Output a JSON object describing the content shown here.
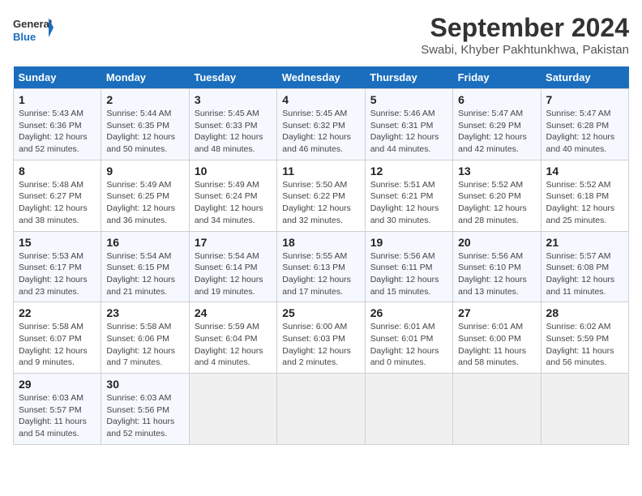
{
  "logo": {
    "text_general": "General",
    "text_blue": "Blue"
  },
  "title": "September 2024",
  "subtitle": "Swabi, Khyber Pakhtunkhwa, Pakistan",
  "days_of_week": [
    "Sunday",
    "Monday",
    "Tuesday",
    "Wednesday",
    "Thursday",
    "Friday",
    "Saturday"
  ],
  "weeks": [
    [
      {
        "day": "1",
        "info": "Sunrise: 5:43 AM\nSunset: 6:36 PM\nDaylight: 12 hours\nand 52 minutes."
      },
      {
        "day": "2",
        "info": "Sunrise: 5:44 AM\nSunset: 6:35 PM\nDaylight: 12 hours\nand 50 minutes."
      },
      {
        "day": "3",
        "info": "Sunrise: 5:45 AM\nSunset: 6:33 PM\nDaylight: 12 hours\nand 48 minutes."
      },
      {
        "day": "4",
        "info": "Sunrise: 5:45 AM\nSunset: 6:32 PM\nDaylight: 12 hours\nand 46 minutes."
      },
      {
        "day": "5",
        "info": "Sunrise: 5:46 AM\nSunset: 6:31 PM\nDaylight: 12 hours\nand 44 minutes."
      },
      {
        "day": "6",
        "info": "Sunrise: 5:47 AM\nSunset: 6:29 PM\nDaylight: 12 hours\nand 42 minutes."
      },
      {
        "day": "7",
        "info": "Sunrise: 5:47 AM\nSunset: 6:28 PM\nDaylight: 12 hours\nand 40 minutes."
      }
    ],
    [
      {
        "day": "8",
        "info": "Sunrise: 5:48 AM\nSunset: 6:27 PM\nDaylight: 12 hours\nand 38 minutes."
      },
      {
        "day": "9",
        "info": "Sunrise: 5:49 AM\nSunset: 6:25 PM\nDaylight: 12 hours\nand 36 minutes."
      },
      {
        "day": "10",
        "info": "Sunrise: 5:49 AM\nSunset: 6:24 PM\nDaylight: 12 hours\nand 34 minutes."
      },
      {
        "day": "11",
        "info": "Sunrise: 5:50 AM\nSunset: 6:22 PM\nDaylight: 12 hours\nand 32 minutes."
      },
      {
        "day": "12",
        "info": "Sunrise: 5:51 AM\nSunset: 6:21 PM\nDaylight: 12 hours\nand 30 minutes."
      },
      {
        "day": "13",
        "info": "Sunrise: 5:52 AM\nSunset: 6:20 PM\nDaylight: 12 hours\nand 28 minutes."
      },
      {
        "day": "14",
        "info": "Sunrise: 5:52 AM\nSunset: 6:18 PM\nDaylight: 12 hours\nand 25 minutes."
      }
    ],
    [
      {
        "day": "15",
        "info": "Sunrise: 5:53 AM\nSunset: 6:17 PM\nDaylight: 12 hours\nand 23 minutes."
      },
      {
        "day": "16",
        "info": "Sunrise: 5:54 AM\nSunset: 6:15 PM\nDaylight: 12 hours\nand 21 minutes."
      },
      {
        "day": "17",
        "info": "Sunrise: 5:54 AM\nSunset: 6:14 PM\nDaylight: 12 hours\nand 19 minutes."
      },
      {
        "day": "18",
        "info": "Sunrise: 5:55 AM\nSunset: 6:13 PM\nDaylight: 12 hours\nand 17 minutes."
      },
      {
        "day": "19",
        "info": "Sunrise: 5:56 AM\nSunset: 6:11 PM\nDaylight: 12 hours\nand 15 minutes."
      },
      {
        "day": "20",
        "info": "Sunrise: 5:56 AM\nSunset: 6:10 PM\nDaylight: 12 hours\nand 13 minutes."
      },
      {
        "day": "21",
        "info": "Sunrise: 5:57 AM\nSunset: 6:08 PM\nDaylight: 12 hours\nand 11 minutes."
      }
    ],
    [
      {
        "day": "22",
        "info": "Sunrise: 5:58 AM\nSunset: 6:07 PM\nDaylight: 12 hours\nand 9 minutes."
      },
      {
        "day": "23",
        "info": "Sunrise: 5:58 AM\nSunset: 6:06 PM\nDaylight: 12 hours\nand 7 minutes."
      },
      {
        "day": "24",
        "info": "Sunrise: 5:59 AM\nSunset: 6:04 PM\nDaylight: 12 hours\nand 4 minutes."
      },
      {
        "day": "25",
        "info": "Sunrise: 6:00 AM\nSunset: 6:03 PM\nDaylight: 12 hours\nand 2 minutes."
      },
      {
        "day": "26",
        "info": "Sunrise: 6:01 AM\nSunset: 6:01 PM\nDaylight: 12 hours\nand 0 minutes."
      },
      {
        "day": "27",
        "info": "Sunrise: 6:01 AM\nSunset: 6:00 PM\nDaylight: 11 hours\nand 58 minutes."
      },
      {
        "day": "28",
        "info": "Sunrise: 6:02 AM\nSunset: 5:59 PM\nDaylight: 11 hours\nand 56 minutes."
      }
    ],
    [
      {
        "day": "29",
        "info": "Sunrise: 6:03 AM\nSunset: 5:57 PM\nDaylight: 11 hours\nand 54 minutes."
      },
      {
        "day": "30",
        "info": "Sunrise: 6:03 AM\nSunset: 5:56 PM\nDaylight: 11 hours\nand 52 minutes."
      },
      {
        "day": "",
        "info": ""
      },
      {
        "day": "",
        "info": ""
      },
      {
        "day": "",
        "info": ""
      },
      {
        "day": "",
        "info": ""
      },
      {
        "day": "",
        "info": ""
      }
    ]
  ]
}
